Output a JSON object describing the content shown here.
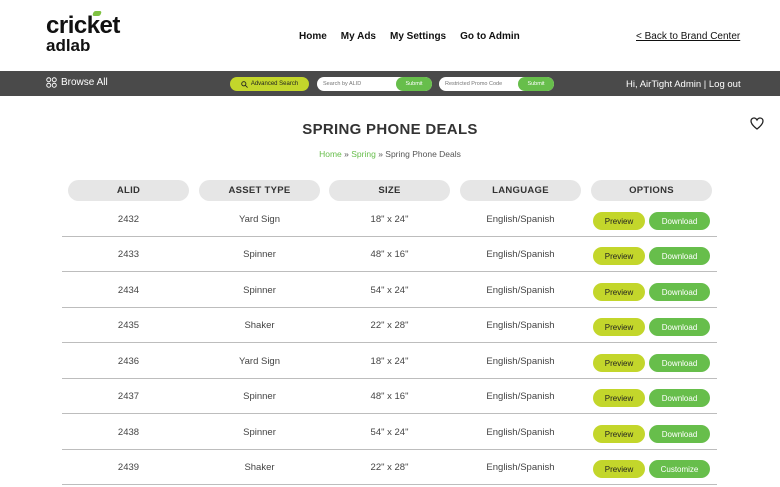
{
  "logo": {
    "line1": "cricket",
    "line2": "adlab"
  },
  "nav": [
    "Home",
    "My Ads",
    "My Settings",
    "Go to Admin"
  ],
  "back_link": "< Back to Brand Center",
  "toolbar": {
    "browse_label": "Browse All",
    "advanced_search": "Advanced Search",
    "search_alid_placeholder": "Search by ALID",
    "promo_placeholder": "Restricted Promo Code",
    "submit_label": "Submit",
    "greeting": "Hi, AirTight Admin | Log out"
  },
  "page_title": "SPRING PHONE DEALS",
  "breadcrumb": {
    "home": "Home",
    "sep1": " » ",
    "spring": "Spring",
    "sep2": " » ",
    "current": "Spring Phone Deals"
  },
  "table": {
    "headers": [
      "ALID",
      "ASSET TYPE",
      "SIZE",
      "LANGUAGE",
      "OPTIONS"
    ],
    "rows": [
      {
        "alid": "2432",
        "type": "Yard Sign",
        "size": "18\" x 24\"",
        "lang": "English/Spanish",
        "preview": "Preview",
        "action": "Download"
      },
      {
        "alid": "2433",
        "type": "Spinner",
        "size": "48\" x 16\"",
        "lang": "English/Spanish",
        "preview": "Preview",
        "action": "Download"
      },
      {
        "alid": "2434",
        "type": "Spinner",
        "size": "54\" x 24\"",
        "lang": "English/Spanish",
        "preview": "Preview",
        "action": "Download"
      },
      {
        "alid": "2435",
        "type": "Shaker",
        "size": "22\" x 28\"",
        "lang": "English/Spanish",
        "preview": "Preview",
        "action": "Download"
      },
      {
        "alid": "2436",
        "type": "Yard Sign",
        "size": "18\" x 24\"",
        "lang": "English/Spanish",
        "preview": "Preview",
        "action": "Download"
      },
      {
        "alid": "2437",
        "type": "Spinner",
        "size": "48\" x 16\"",
        "lang": "English/Spanish",
        "preview": "Preview",
        "action": "Download"
      },
      {
        "alid": "2438",
        "type": "Spinner",
        "size": "54\" x 24\"",
        "lang": "English/Spanish",
        "preview": "Preview",
        "action": "Download"
      },
      {
        "alid": "2439",
        "type": "Shaker",
        "size": "22\" x 28\"",
        "lang": "English/Spanish",
        "preview": "Preview",
        "action": "Customize"
      }
    ]
  },
  "colors": {
    "accent_lime": "#c3d62b",
    "accent_green": "#67be4b",
    "toolbar_bg": "#4a4a4a",
    "header_pill": "#e6e6e6"
  }
}
